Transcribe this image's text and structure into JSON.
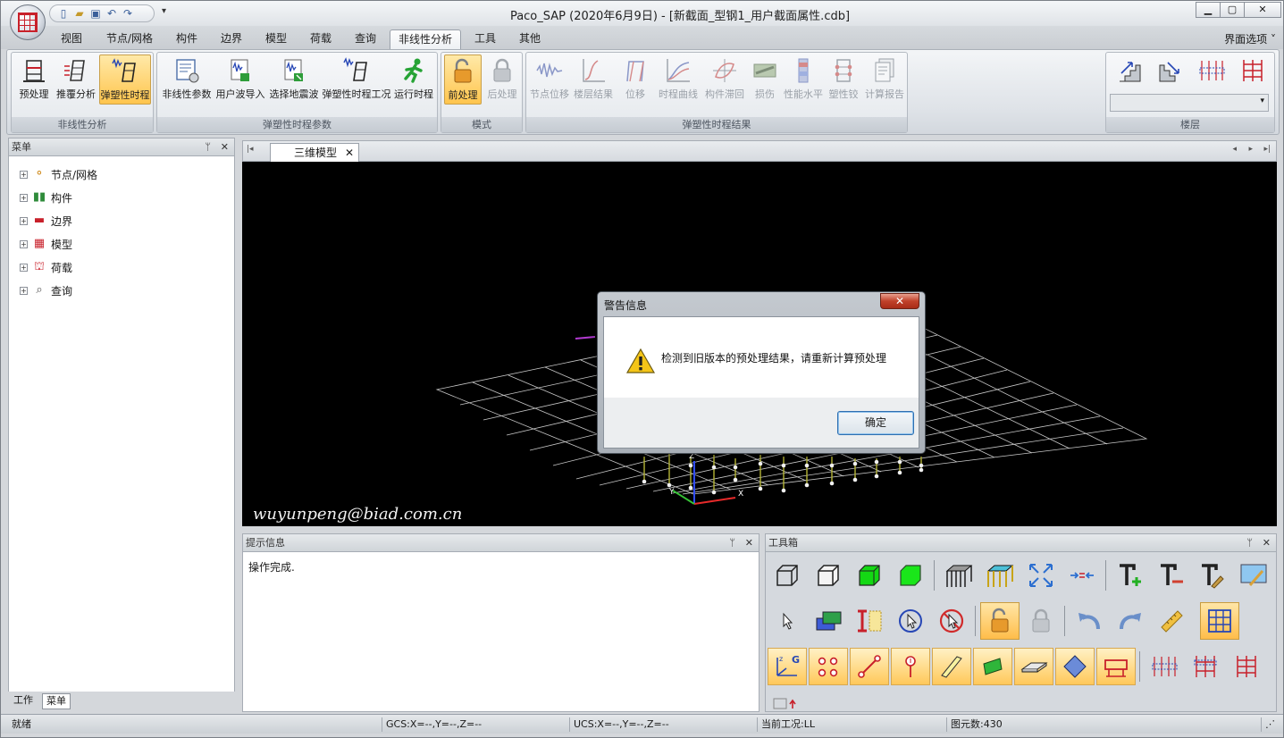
{
  "window": {
    "title": "Paco_SAP  (2020年6月9日) - [新截面_型钢1_用户截面属性.cdb]",
    "minimize": "▁",
    "maximize": "▢",
    "close": "✕"
  },
  "quick_access": {
    "more": "▾"
  },
  "ribbon_tabs": [
    "视图",
    "节点/网格",
    "构件",
    "边界",
    "模型",
    "荷载",
    "查询",
    "非线性分析",
    "工具",
    "其他"
  ],
  "active_tab": "非线性分析",
  "ui_options": "界面选项  ˅",
  "ribbon": {
    "groups": {
      "nonlinear": "非线性分析",
      "params": "弹塑性时程参数",
      "mode": "模式",
      "results": "弹塑性时程结果",
      "floor": "楼层"
    },
    "buttons": {
      "preprocess": "预处理",
      "pushover": "推覆分析",
      "elastoplastic_th": "弹塑性时程",
      "nonlinear_params": "非线性参数",
      "user_wave_import": "用户波导入",
      "select_wave": "选择地震波",
      "th_case": "弹塑性时程工况",
      "run_th": "运行时程",
      "pre": "前处理",
      "post": "后处理",
      "node_disp": "节点位移",
      "story_result": "楼层结果",
      "displacement": "位移",
      "th_curve": "时程曲线",
      "hysteresis": "构件滞回",
      "damage": "损伤",
      "performance": "性能水平",
      "plastic_hinge": "塑性铰",
      "report": "计算报告"
    }
  },
  "menu_panel": {
    "title": "菜单",
    "pin": "ᛘ",
    "close": "✕",
    "items": [
      "节点/网格",
      "构件",
      "边界",
      "模型",
      "荷载",
      "查询"
    ]
  },
  "bottom_tabs": [
    "工作",
    "菜单"
  ],
  "document": {
    "tab": "三维模型",
    "close": "✕",
    "first": "|◂",
    "prev": "◂",
    "next": "▸",
    "last": "▸|"
  },
  "viewport": {
    "watermark": "wuyunpeng@biad.com.cn",
    "axis_z": "Z",
    "axis_y": "Y",
    "axis_x": "X"
  },
  "dialog": {
    "title": "警告信息",
    "close": "✕",
    "message": "检测到旧版本的预处理结果，请重新计算预处理",
    "ok": "确定"
  },
  "info_panel": {
    "title": "提示信息",
    "pin": "ᛘ",
    "close": "✕",
    "text": "操作完成."
  },
  "toolbox": {
    "title": "工具箱",
    "pin": "ᛘ",
    "close": "✕"
  },
  "statusbar": {
    "ready": "就绪",
    "gcs": "GCS:X=--,Y=--,Z=--",
    "ucs": "UCS:X=--,Y=--,Z=--",
    "load_case": "当前工况:LL",
    "element_count": "图元数:430"
  },
  "colors": {
    "accent_orange": "#ffc54d",
    "viewport_bg": "#000000",
    "grid": "#c8c8c8",
    "column": "#b5b536"
  }
}
